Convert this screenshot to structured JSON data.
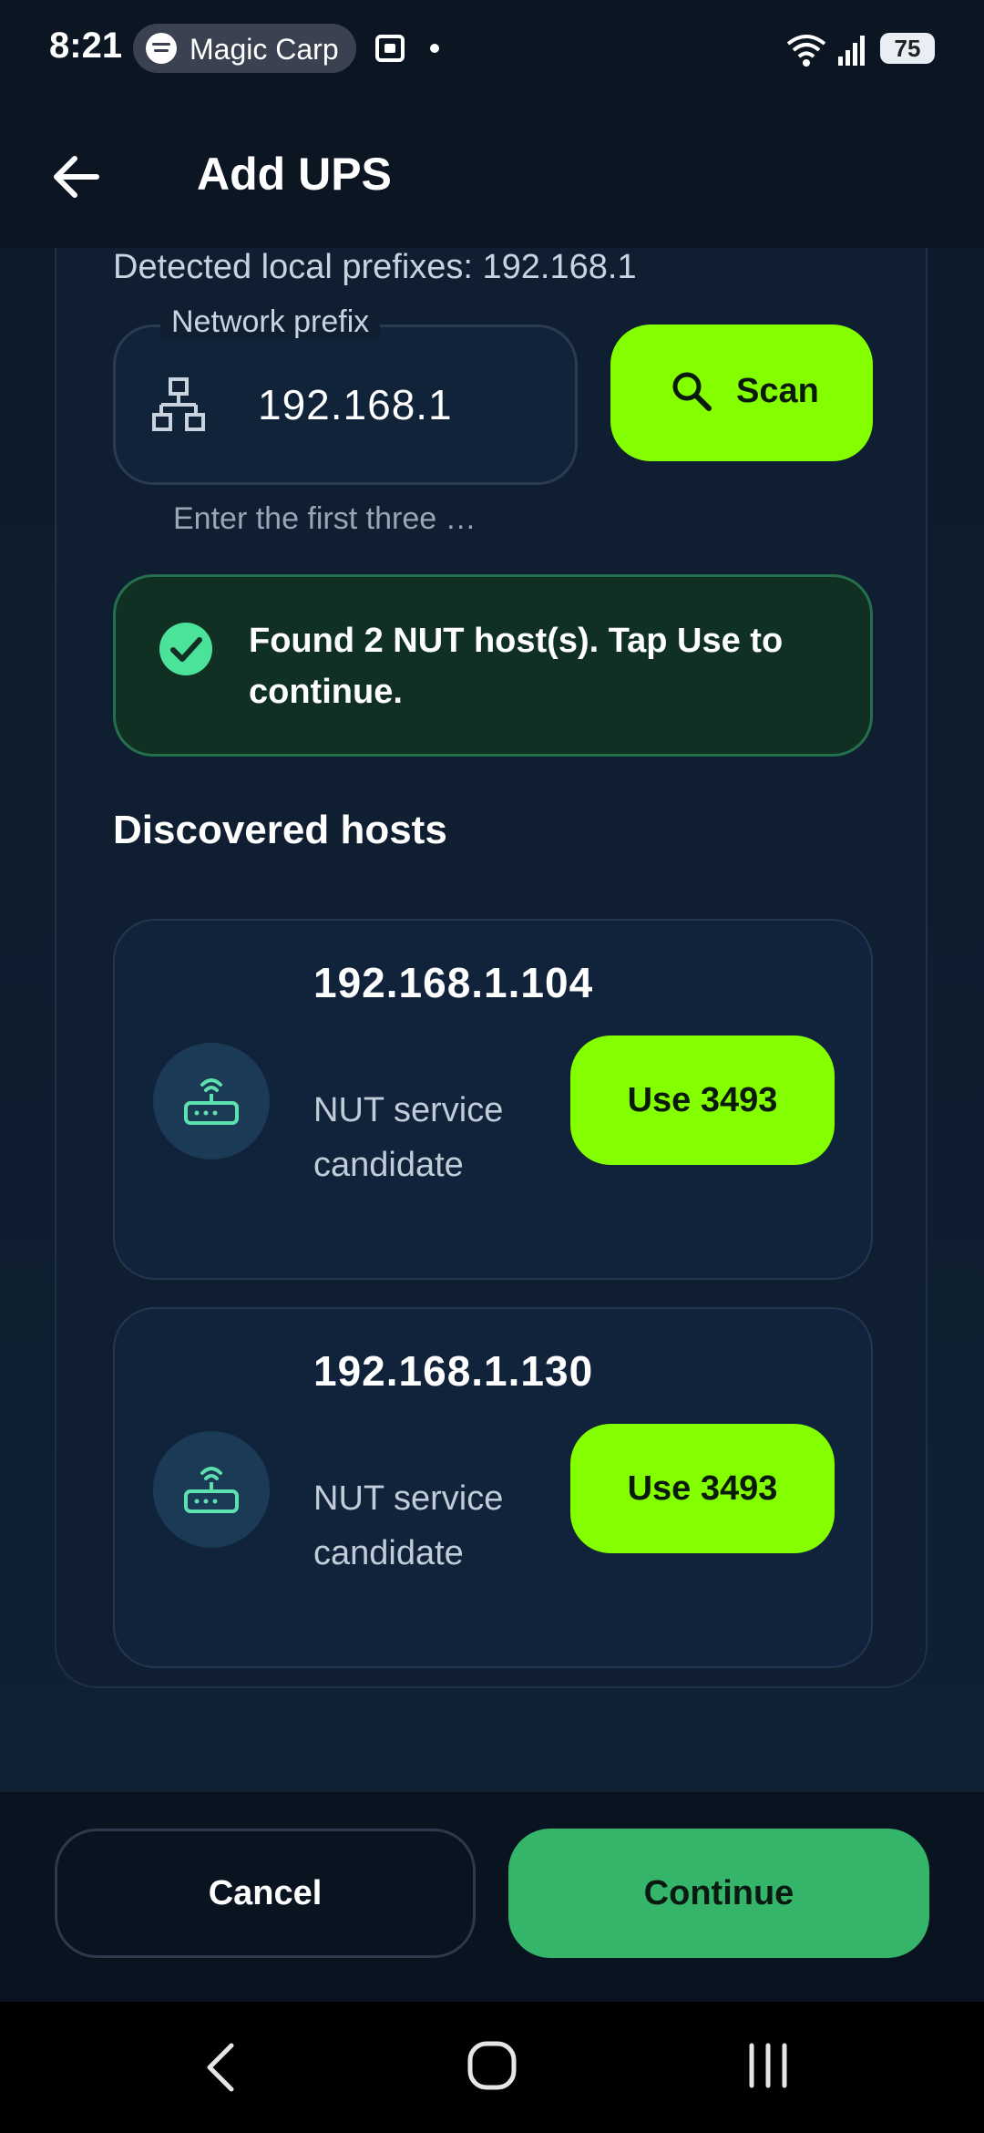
{
  "status_bar": {
    "time": "8:21",
    "media_pill": "Magic Carp",
    "battery": "75"
  },
  "header": {
    "title": "Add UPS"
  },
  "scan": {
    "detected_text": "Detected local prefixes: 192.168.1",
    "prefix_label": "Network prefix",
    "prefix_value": "192.168.1",
    "helper_text": "Enter the first three …",
    "scan_label": "Scan"
  },
  "result": {
    "message": "Found 2 NUT host(s). Tap Use to continue."
  },
  "hosts_section": {
    "title": "Discovered hosts",
    "hosts": [
      {
        "ip": "192.168.1.104",
        "subtitle": "NUT service candidate",
        "action": "Use 3493"
      },
      {
        "ip": "192.168.1.130",
        "subtitle": "NUT service candidate",
        "action": "Use 3493"
      }
    ]
  },
  "footer": {
    "cancel": "Cancel",
    "continue": "Continue"
  },
  "colors": {
    "accent": "#84ff00",
    "continue": "#35b56a",
    "success_bg": "#0f3022"
  }
}
